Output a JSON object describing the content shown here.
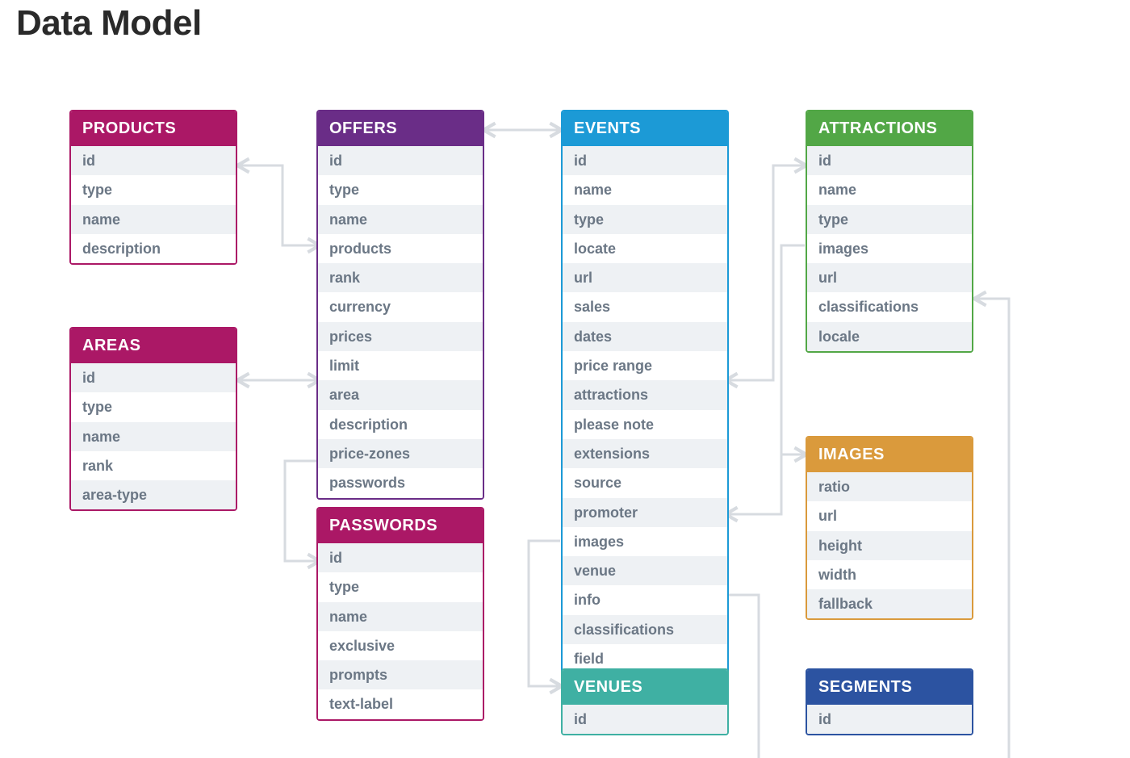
{
  "title": "Data Model",
  "colors": {
    "magenta": "#ab1866",
    "purple": "#6a2d87",
    "blue": "#1c9ad6",
    "green": "#52a746",
    "amber": "#da9a3c",
    "navy": "#2c53a1",
    "teal": "#3fb0a3",
    "connector": "#d7dbe0",
    "field_text": "#6b7785",
    "stripe": "#eef1f4"
  },
  "entities": {
    "products": {
      "title": "PRODUCTS",
      "fields": [
        "id",
        "type",
        "name",
        "description"
      ]
    },
    "areas": {
      "title": "AREAS",
      "fields": [
        "id",
        "type",
        "name",
        "rank",
        "area-type"
      ]
    },
    "offers": {
      "title": "OFFERS",
      "fields": [
        "id",
        "type",
        "name",
        "products",
        "rank",
        "currency",
        "prices",
        "limit",
        "area",
        "description",
        "price-zones",
        "passwords"
      ]
    },
    "passwords": {
      "title": "PASSWORDS",
      "fields": [
        "id",
        "type",
        "name",
        "exclusive",
        "prompts",
        "text-label"
      ]
    },
    "events": {
      "title": "EVENTS",
      "fields": [
        "id",
        "name",
        "type",
        "locate",
        "url",
        "sales",
        "dates",
        "price range",
        "attractions",
        "please note",
        "extensions",
        "source",
        "promoter",
        "images",
        "venue",
        "info",
        "classifications",
        "field"
      ]
    },
    "attractions": {
      "title": "ATTRACTIONS",
      "fields": [
        "id",
        "name",
        "type",
        "images",
        "url",
        "classifications",
        "locale"
      ]
    },
    "images": {
      "title": "IMAGES",
      "fields": [
        "ratio",
        "url",
        "height",
        "width",
        "fallback"
      ]
    },
    "venues": {
      "title": "VENUES",
      "fields": [
        "id"
      ]
    },
    "segments": {
      "title": "SEGMENTS",
      "fields": [
        "id"
      ]
    }
  },
  "connections": [
    {
      "from": "offers.products",
      "to": "products.id"
    },
    {
      "from": "offers.area",
      "to": "areas.id"
    },
    {
      "from": "offers.passwords",
      "to": "passwords.id"
    },
    {
      "from": "offers.header",
      "to": "events.header"
    },
    {
      "from": "events.attractions",
      "to": "attractions.id"
    },
    {
      "from": "events.images",
      "to": "images.header"
    },
    {
      "from": "events.classifications",
      "to": "segments.header"
    },
    {
      "from": "events.venue",
      "to": "venues.header"
    },
    {
      "from": "attractions.images",
      "to": "images.header"
    },
    {
      "from": "attractions.classifications",
      "to": "segments.header"
    }
  ]
}
